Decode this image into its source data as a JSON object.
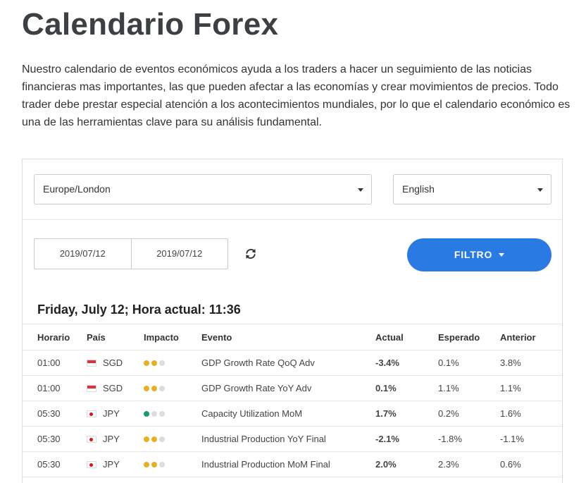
{
  "page": {
    "title": "Calendario Forex",
    "intro": "Nuestro calendario de eventos económicos ayuda a los traders a hacer un seguimiento de las noticias financieras mas importantes, las que pueden afectar a las economías y crear movimientos de precios. Todo trader debe prestar especial atención a los acontecimientos mundiales, por lo que el calendario económico es una de las herramientas clave para su análisis fundamental."
  },
  "filters": {
    "timezone": "Europe/London",
    "language": "English",
    "date_from": "2019/07/12",
    "date_to": "2019/07/12",
    "filter_label": "FILTRO"
  },
  "calendar": {
    "date_heading": "Friday, July 12; Hora actual: 11:36",
    "columns": [
      "Horario",
      "País",
      "Impacto",
      "Evento",
      "Actual",
      "Esperado",
      "Anterior"
    ],
    "rows": [
      {
        "time": "01:00",
        "country": "SGD",
        "impact": 2,
        "event": "GDP Growth Rate QoQ Adv",
        "actual": "-3.4%",
        "direction": "neg",
        "expected": "0.1%",
        "previous": "3.8%"
      },
      {
        "time": "01:00",
        "country": "SGD",
        "impact": 2,
        "event": "GDP Growth Rate YoY Adv",
        "actual": "0.1%",
        "direction": "neg",
        "expected": "1.1%",
        "previous": "1.1%"
      },
      {
        "time": "05:30",
        "country": "JPY",
        "impact": 1,
        "event": "Capacity Utilization MoM",
        "actual": "1.7%",
        "direction": "pos",
        "expected": "0.2%",
        "previous": "1.6%"
      },
      {
        "time": "05:30",
        "country": "JPY",
        "impact": 2,
        "event": "Industrial Production YoY Final",
        "actual": "-2.1%",
        "direction": "neg",
        "expected": "-1.8%",
        "previous": "-1.1%"
      },
      {
        "time": "05:30",
        "country": "JPY",
        "impact": 2,
        "event": "Industrial Production MoM Final",
        "actual": "2.0%",
        "direction": "neg",
        "expected": "2.3%",
        "previous": "0.6%"
      }
    ]
  },
  "icons": {
    "refresh": "refresh-icon",
    "caret": "caret-down-icon"
  },
  "colors": {
    "accent": "#2a7ae4",
    "negative": "#d12e3a",
    "positive": "#1a9c6a",
    "impact_medium": "#e6b120",
    "impact_inactive": "#dddddd"
  }
}
